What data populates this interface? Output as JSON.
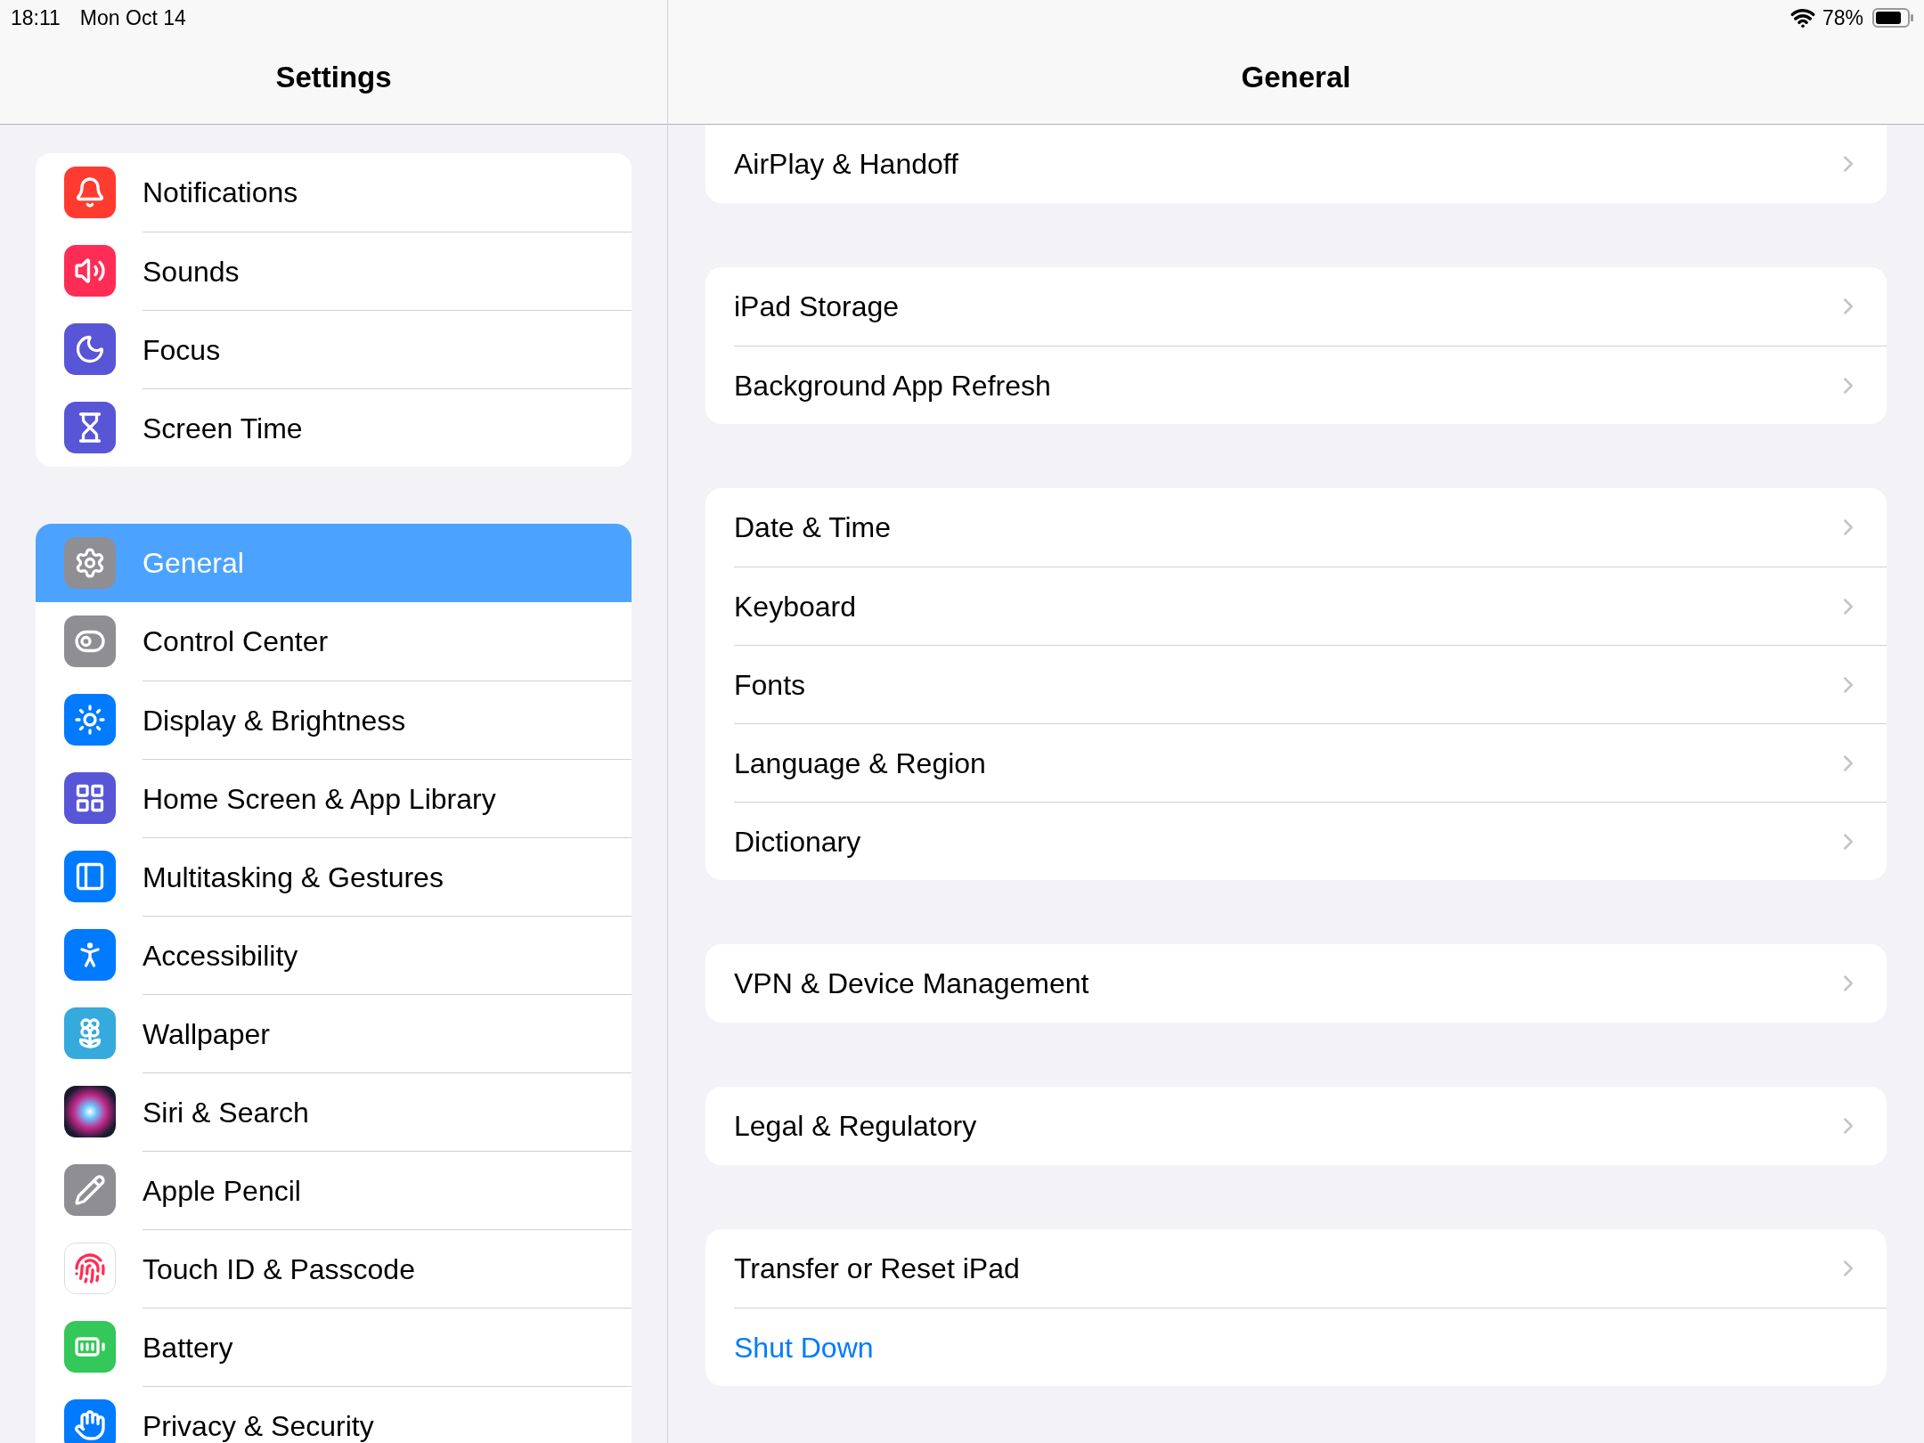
{
  "status_bar": {
    "time": "18:11",
    "date": "Mon Oct 14",
    "battery_percent": "78%"
  },
  "sidebar": {
    "title": "Settings",
    "groups": [
      {
        "items": [
          {
            "label": "Notifications",
            "selected": false
          },
          {
            "label": "Sounds",
            "selected": false
          },
          {
            "label": "Focus",
            "selected": false
          },
          {
            "label": "Screen Time",
            "selected": false
          }
        ]
      },
      {
        "items": [
          {
            "label": "General",
            "selected": true
          },
          {
            "label": "Control Center",
            "selected": false
          },
          {
            "label": "Display & Brightness",
            "selected": false
          },
          {
            "label": "Home Screen & App Library",
            "selected": false
          },
          {
            "label": "Multitasking & Gestures",
            "selected": false
          },
          {
            "label": "Accessibility",
            "selected": false
          },
          {
            "label": "Wallpaper",
            "selected": false
          },
          {
            "label": "Siri & Search",
            "selected": false
          },
          {
            "label": "Apple Pencil",
            "selected": false
          },
          {
            "label": "Touch ID & Passcode",
            "selected": false
          },
          {
            "label": "Battery",
            "selected": false
          },
          {
            "label": "Privacy & Security",
            "selected": false
          }
        ]
      }
    ]
  },
  "detail": {
    "title": "General",
    "sections": [
      {
        "rows": [
          {
            "kind": "link",
            "label": "AirPlay & Handoff"
          }
        ]
      },
      {
        "rows": [
          {
            "kind": "link",
            "label": "iPad Storage"
          },
          {
            "kind": "link",
            "label": "Background App Refresh"
          }
        ]
      },
      {
        "rows": [
          {
            "kind": "link",
            "label": "Date & Time"
          },
          {
            "kind": "link",
            "label": "Keyboard"
          },
          {
            "kind": "link",
            "label": "Fonts"
          },
          {
            "kind": "link",
            "label": "Language & Region"
          },
          {
            "kind": "link",
            "label": "Dictionary"
          }
        ]
      },
      {
        "rows": [
          {
            "kind": "link",
            "label": "VPN & Device Management"
          }
        ]
      },
      {
        "rows": [
          {
            "kind": "link",
            "label": "Legal & Regulatory"
          }
        ]
      },
      {
        "rows": [
          {
            "kind": "link",
            "label": "Transfer or Reset iPad"
          },
          {
            "kind": "action",
            "label": "Shut Down"
          }
        ]
      }
    ]
  }
}
